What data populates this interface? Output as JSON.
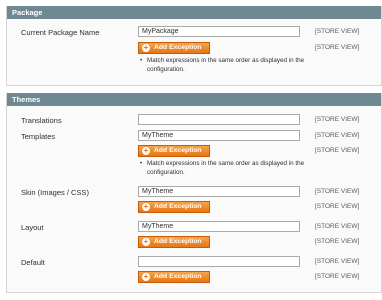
{
  "package": {
    "title": "Package",
    "current_package": {
      "label": "Current Package Name",
      "value": "MyPackage",
      "scope": "[STORE VIEW]",
      "button": "Add Exception",
      "scope_button": "[STORE VIEW]",
      "note": "Match expressions in the same order as displayed in the configuration."
    }
  },
  "themes": {
    "title": "Themes",
    "translations": {
      "label": "Translations",
      "value": "",
      "scope": "[STORE VIEW]"
    },
    "templates": {
      "label": "Templates",
      "value": "MyTheme",
      "scope": "[STORE VIEW]",
      "button": "Add Exception",
      "scope_button": "[STORE VIEW]",
      "note": "Match expressions in the same order as displayed in the configuration."
    },
    "skin": {
      "label": "Skin (Images / CSS)",
      "value": "MyTheme",
      "scope": "[STORE VIEW]",
      "button": "Add Exception",
      "scope_button": "[STORE VIEW]"
    },
    "layout": {
      "label": "Layout",
      "value": "MyTheme",
      "scope": "[STORE VIEW]",
      "button": "Add Exception",
      "scope_button": "[STORE VIEW]"
    },
    "default": {
      "label": "Default",
      "value": "",
      "scope": "[STORE VIEW]",
      "button": "Add Exception",
      "scope_button": "[STORE VIEW]"
    }
  },
  "bullet_glyph": "•",
  "plus_glyph": "+",
  "colors": {
    "section_header": "#6f8992",
    "button_orange": "#e87512",
    "scope_text": "#555e63"
  }
}
